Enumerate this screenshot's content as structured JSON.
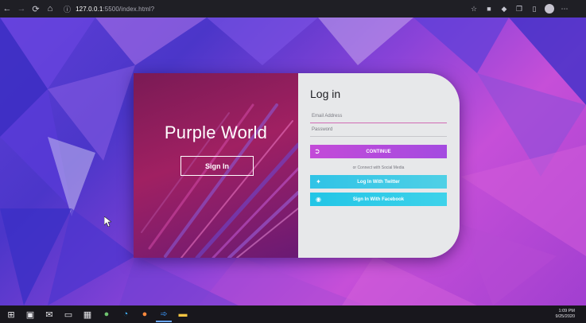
{
  "browser": {
    "address_info_icon": "info-icon",
    "url_host": "127.0.0.1",
    "url_rest": ":5500/index.html?",
    "icons": {
      "back": "back-arrow-icon",
      "forward": "forward-arrow-icon",
      "refresh": "refresh-icon",
      "home": "home-icon",
      "favorite": "star-icon",
      "profile": "avatar"
    }
  },
  "card": {
    "brand_title": "Purple World",
    "signin_label": "Sign In",
    "login_title": "Log in",
    "email_placeholder": "Email Address",
    "password_placeholder": "Password",
    "continue_label": "CONTINUE",
    "social_caption": "or Connect with Social Media",
    "twitter_label": "Log In With Twitter",
    "facebook_label": "Sign In With Facebook"
  },
  "taskbar": {
    "time": "1:09 PM",
    "date": "9/25/2020"
  },
  "colors": {
    "accent_purple": "#a44be0",
    "social_cyan": "#30c3e6",
    "left_panel": "#a02062"
  }
}
